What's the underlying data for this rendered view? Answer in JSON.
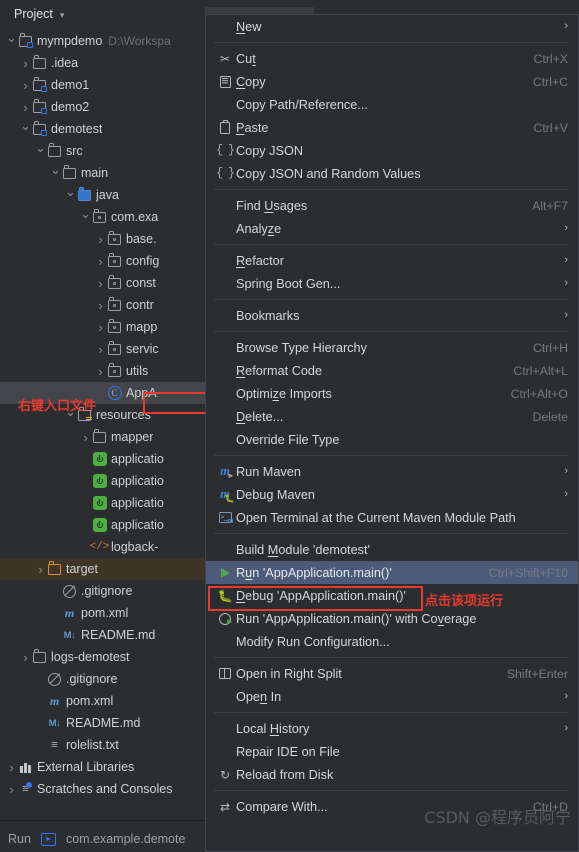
{
  "window": {
    "panel_title": "Project",
    "run_bar": {
      "label": "Run",
      "config": "com.example.demote"
    }
  },
  "tree": {
    "items": [
      {
        "indent": 0,
        "arrow": "v",
        "icon": "module-folder-icon",
        "label": "mympdemo",
        "sub": "D:\\Workspa",
        "state": "normal"
      },
      {
        "indent": 1,
        "arrow": ">",
        "icon": "folder-icon",
        "label": ".idea",
        "sub": "",
        "state": "normal"
      },
      {
        "indent": 1,
        "arrow": ">",
        "icon": "module-folder-icon",
        "label": "demo1",
        "sub": "",
        "state": "normal"
      },
      {
        "indent": 1,
        "arrow": ">",
        "icon": "module-folder-icon",
        "label": "demo2",
        "sub": "",
        "state": "normal"
      },
      {
        "indent": 1,
        "arrow": "v",
        "icon": "module-folder-icon",
        "label": "demotest",
        "sub": "",
        "state": "normal"
      },
      {
        "indent": 2,
        "arrow": "v",
        "icon": "folder-icon",
        "label": "src",
        "sub": "",
        "state": "normal"
      },
      {
        "indent": 3,
        "arrow": "v",
        "icon": "folder-icon",
        "label": "main",
        "sub": "",
        "state": "normal"
      },
      {
        "indent": 4,
        "arrow": "v",
        "icon": "source-folder-icon",
        "label": "java",
        "sub": "",
        "state": "normal"
      },
      {
        "indent": 5,
        "arrow": "v",
        "icon": "package-icon",
        "label": "com.exa",
        "sub": "",
        "state": "normal"
      },
      {
        "indent": 6,
        "arrow": ">",
        "icon": "package-icon",
        "label": "base.",
        "sub": "",
        "state": "normal"
      },
      {
        "indent": 6,
        "arrow": ">",
        "icon": "package-icon",
        "label": "config",
        "sub": "",
        "state": "normal"
      },
      {
        "indent": 6,
        "arrow": ">",
        "icon": "package-icon",
        "label": "const",
        "sub": "",
        "state": "normal"
      },
      {
        "indent": 6,
        "arrow": ">",
        "icon": "package-icon",
        "label": "contr",
        "sub": "",
        "state": "normal"
      },
      {
        "indent": 6,
        "arrow": ">",
        "icon": "package-icon",
        "label": "mapp",
        "sub": "",
        "state": "normal"
      },
      {
        "indent": 6,
        "arrow": ">",
        "icon": "package-icon",
        "label": "servic",
        "sub": "",
        "state": "normal"
      },
      {
        "indent": 6,
        "arrow": ">",
        "icon": "package-icon",
        "label": "utils",
        "sub": "",
        "state": "normal"
      },
      {
        "indent": 6,
        "arrow": "",
        "icon": "java-class-icon",
        "label": "AppA",
        "sub": "",
        "state": "selected"
      },
      {
        "indent": 4,
        "arrow": "v",
        "icon": "resource-folder-icon",
        "label": "resources",
        "sub": "",
        "state": "normal"
      },
      {
        "indent": 5,
        "arrow": ">",
        "icon": "folder-icon",
        "label": "mapper",
        "sub": "",
        "state": "normal"
      },
      {
        "indent": 5,
        "arrow": "",
        "icon": "spring-yaml-icon",
        "label": "applicatio",
        "sub": "",
        "state": "normal"
      },
      {
        "indent": 5,
        "arrow": "",
        "icon": "spring-yaml-icon",
        "label": "applicatio",
        "sub": "",
        "state": "normal"
      },
      {
        "indent": 5,
        "arrow": "",
        "icon": "spring-yaml-icon",
        "label": "applicatio",
        "sub": "",
        "state": "normal"
      },
      {
        "indent": 5,
        "arrow": "",
        "icon": "spring-yaml-icon",
        "label": "applicatio",
        "sub": "",
        "state": "normal"
      },
      {
        "indent": 5,
        "arrow": "",
        "icon": "xml-icon",
        "label": "logback-",
        "sub": "",
        "state": "normal"
      },
      {
        "indent": 2,
        "arrow": ">",
        "icon": "target-folder-icon",
        "label": "target",
        "sub": "",
        "state": "target"
      },
      {
        "indent": 3,
        "arrow": "",
        "icon": "gitignore-icon",
        "label": ".gitignore",
        "sub": "",
        "state": "normal"
      },
      {
        "indent": 3,
        "arrow": "",
        "icon": "maven-pom-icon",
        "label": "pom.xml",
        "sub": "",
        "state": "normal"
      },
      {
        "indent": 3,
        "arrow": "",
        "icon": "markdown-icon",
        "label": "README.md",
        "sub": "",
        "state": "normal"
      },
      {
        "indent": 1,
        "arrow": ">",
        "icon": "folder-icon",
        "label": "logs-demotest",
        "sub": "",
        "state": "normal"
      },
      {
        "indent": 2,
        "arrow": "",
        "icon": "gitignore-icon",
        "label": ".gitignore",
        "sub": "",
        "state": "normal"
      },
      {
        "indent": 2,
        "arrow": "",
        "icon": "maven-pom-icon",
        "label": "pom.xml",
        "sub": "",
        "state": "normal"
      },
      {
        "indent": 2,
        "arrow": "",
        "icon": "markdown-icon",
        "label": "README.md",
        "sub": "",
        "state": "normal"
      },
      {
        "indent": 2,
        "arrow": "",
        "icon": "text-file-icon",
        "label": "rolelist.txt",
        "sub": "",
        "state": "normal"
      },
      {
        "indent": 0,
        "arrow": ">",
        "icon": "external-libraries-icon",
        "label": "External Libraries",
        "sub": "",
        "state": "normal"
      },
      {
        "indent": 0,
        "arrow": ">",
        "icon": "scratches-icon",
        "label": "Scratches and Consoles",
        "sub": "",
        "state": "normal"
      }
    ]
  },
  "annotations": {
    "tree_note": "右键入口文件",
    "menu_note": "点击该项运行",
    "watermark": "CSDN @程序员阿宁"
  },
  "context_menu": {
    "items": [
      {
        "type": "item",
        "icon": "",
        "label": "New",
        "mnemonic": "N",
        "shortcut": "",
        "arrow": true
      },
      {
        "type": "separator"
      },
      {
        "type": "item",
        "icon": "cut-icon",
        "label": "Cut",
        "mnemonic": "t",
        "shortcut": "Ctrl+X",
        "arrow": false
      },
      {
        "type": "item",
        "icon": "copy-icon",
        "label": "Copy",
        "mnemonic": "C",
        "shortcut": "Ctrl+C",
        "arrow": false
      },
      {
        "type": "item",
        "icon": "",
        "label": "Copy Path/Reference...",
        "mnemonic": "",
        "shortcut": "",
        "arrow": false
      },
      {
        "type": "item",
        "icon": "paste-icon",
        "label": "Paste",
        "mnemonic": "P",
        "shortcut": "Ctrl+V",
        "arrow": false
      },
      {
        "type": "item",
        "icon": "json-icon",
        "label": "Copy JSON",
        "mnemonic": "",
        "shortcut": "",
        "arrow": false
      },
      {
        "type": "item",
        "icon": "json-icon",
        "label": "Copy JSON and Random Values",
        "mnemonic": "",
        "shortcut": "",
        "arrow": false
      },
      {
        "type": "separator"
      },
      {
        "type": "item",
        "icon": "",
        "label": "Find Usages",
        "mnemonic": "U",
        "shortcut": "Alt+F7",
        "arrow": false
      },
      {
        "type": "item",
        "icon": "",
        "label": "Analyze",
        "mnemonic": "z",
        "shortcut": "",
        "arrow": true
      },
      {
        "type": "separator"
      },
      {
        "type": "item",
        "icon": "",
        "label": "Refactor",
        "mnemonic": "R",
        "shortcut": "",
        "arrow": true
      },
      {
        "type": "item",
        "icon": "",
        "label": "Spring Boot Gen...",
        "mnemonic": "",
        "shortcut": "",
        "arrow": true
      },
      {
        "type": "separator"
      },
      {
        "type": "item",
        "icon": "",
        "label": "Bookmarks",
        "mnemonic": "",
        "shortcut": "",
        "arrow": true
      },
      {
        "type": "separator"
      },
      {
        "type": "item",
        "icon": "",
        "label": "Browse Type Hierarchy",
        "mnemonic": "",
        "shortcut": "Ctrl+H",
        "arrow": false
      },
      {
        "type": "item",
        "icon": "",
        "label": "Reformat Code",
        "mnemonic": "R",
        "shortcut": "Ctrl+Alt+L",
        "arrow": false
      },
      {
        "type": "item",
        "icon": "",
        "label": "Optimize Imports",
        "mnemonic": "z",
        "shortcut": "Ctrl+Alt+O",
        "arrow": false
      },
      {
        "type": "item",
        "icon": "",
        "label": "Delete...",
        "mnemonic": "D",
        "shortcut": "Delete",
        "arrow": false
      },
      {
        "type": "item",
        "icon": "",
        "label": "Override File Type",
        "mnemonic": "",
        "shortcut": "",
        "arrow": false
      },
      {
        "type": "separator"
      },
      {
        "type": "item",
        "icon": "maven-run-icon",
        "label": "Run Maven",
        "mnemonic": "",
        "shortcut": "",
        "arrow": true
      },
      {
        "type": "item",
        "icon": "maven-debug-icon",
        "label": "Debug Maven",
        "mnemonic": "",
        "shortcut": "",
        "arrow": true
      },
      {
        "type": "item",
        "icon": "terminal-maven-icon",
        "label": "Open Terminal at the Current Maven Module Path",
        "mnemonic": "",
        "shortcut": "",
        "arrow": false
      },
      {
        "type": "separator"
      },
      {
        "type": "item",
        "icon": "",
        "label": "Build Module 'demotest'",
        "mnemonic": "M",
        "shortcut": "",
        "arrow": false
      },
      {
        "type": "item",
        "icon": "run-icon",
        "label": "Run 'AppApplication.main()'",
        "mnemonic": "u",
        "shortcut": "Ctrl+Shift+F10",
        "arrow": false,
        "highlight": true
      },
      {
        "type": "item",
        "icon": "debug-icon",
        "label": "Debug 'AppApplication.main()'",
        "mnemonic": "D",
        "shortcut": "",
        "arrow": false
      },
      {
        "type": "item",
        "icon": "coverage-icon",
        "label": "Run 'AppApplication.main()' with Coverage",
        "mnemonic": "v",
        "shortcut": "",
        "arrow": false
      },
      {
        "type": "item",
        "icon": "",
        "label": "Modify Run Configuration...",
        "mnemonic": "",
        "shortcut": "",
        "arrow": false
      },
      {
        "type": "separator"
      },
      {
        "type": "item",
        "icon": "split-icon",
        "label": "Open in Right Split",
        "mnemonic": "",
        "shortcut": "Shift+Enter",
        "arrow": false
      },
      {
        "type": "item",
        "icon": "",
        "label": "Open In",
        "mnemonic": "n",
        "shortcut": "",
        "arrow": true
      },
      {
        "type": "separator"
      },
      {
        "type": "item",
        "icon": "",
        "label": "Local History",
        "mnemonic": "H",
        "shortcut": "",
        "arrow": true
      },
      {
        "type": "item",
        "icon": "",
        "label": "Repair IDE on File",
        "mnemonic": "",
        "shortcut": "",
        "arrow": false
      },
      {
        "type": "item",
        "icon": "reload-icon",
        "label": "Reload from Disk",
        "mnemonic": "",
        "shortcut": "",
        "arrow": false
      },
      {
        "type": "separator"
      },
      {
        "type": "item",
        "icon": "compare-icon",
        "label": "Compare With...",
        "mnemonic": "",
        "shortcut": "Ctrl+D",
        "arrow": false
      }
    ]
  },
  "colors": {
    "background": "#2b2d30",
    "menu_highlight": "#4b5b79",
    "annotation_red": "#e83b2f",
    "selection_grey": "#43454a",
    "target_brown": "#3f3526"
  }
}
